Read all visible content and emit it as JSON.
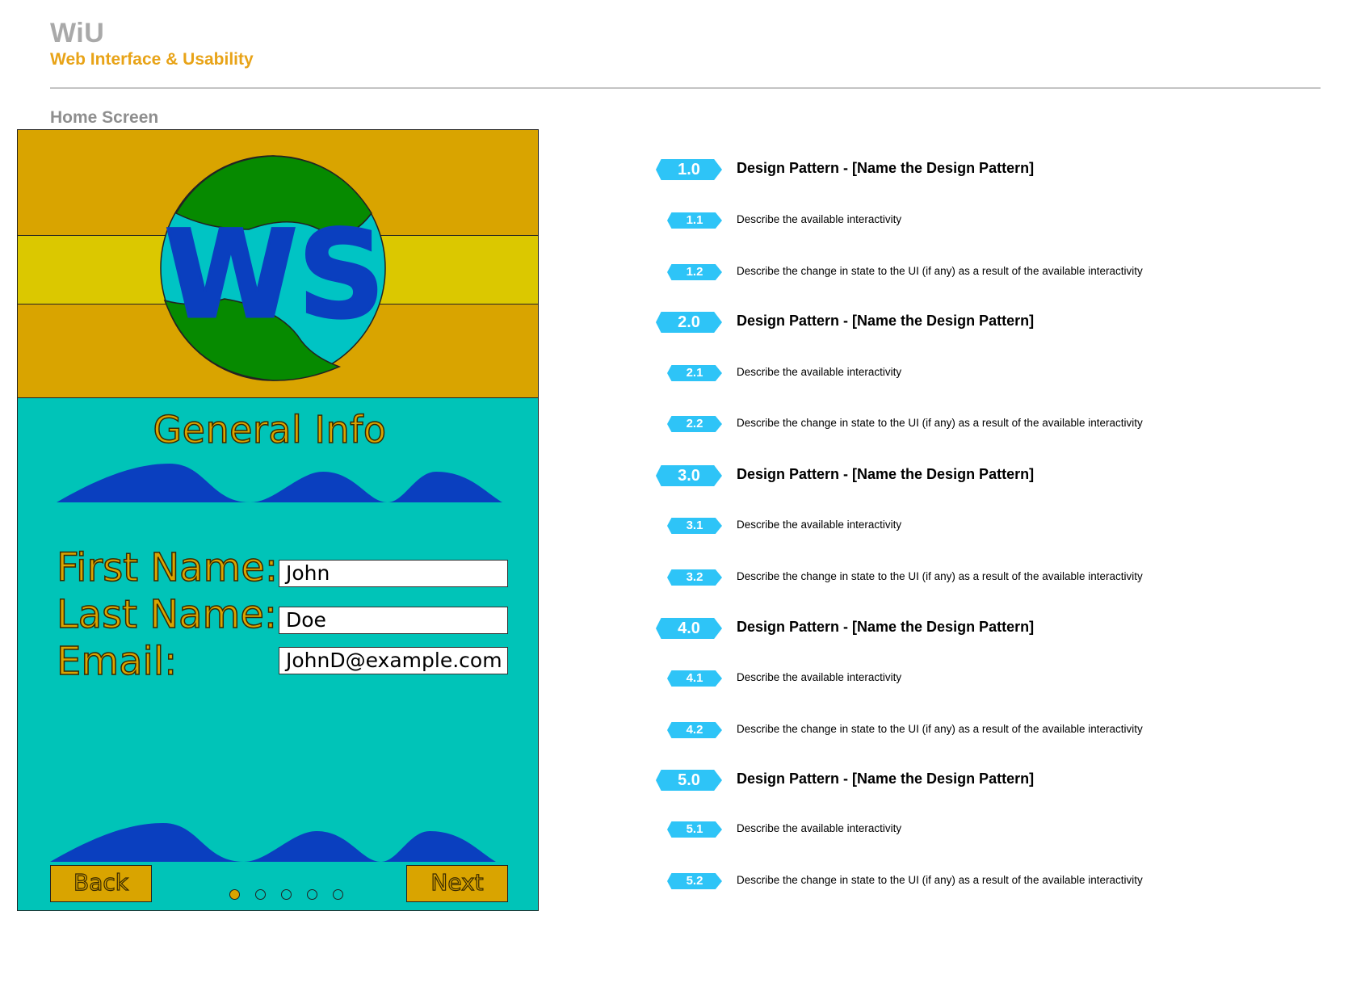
{
  "brand": {
    "title": "WiU",
    "subtitle": "Web Interface & Usability"
  },
  "screen_label": "Home Screen",
  "colors": {
    "accent_gold": "#d9a400",
    "stripe_yellow": "#dbc800",
    "teal": "#00c4b8",
    "wave_blue": "#0a3fbf",
    "globe_green": "#068a00",
    "globe_cyan": "#00c4c4",
    "badge_blue": "#2ec4f7"
  },
  "phone": {
    "logo_text": "WS",
    "section_title": "General Info",
    "form": [
      {
        "label": "First Name:",
        "value": "John"
      },
      {
        "label": "Last Name:",
        "value": "Doe"
      },
      {
        "label": "Email:",
        "value": "JohnD@example.com"
      }
    ],
    "back_label": "Back",
    "next_label": "Next",
    "pager": {
      "count": 5,
      "active_index": 0
    }
  },
  "annotations": [
    {
      "num": "1.0",
      "title": "Design Pattern - [Name the Design Pattern]",
      "items": [
        {
          "num": "1.1",
          "text": "Describe the available interactivity"
        },
        {
          "num": "1.2",
          "text": "Describe the change in state to the UI (if any) as a result of the available interactivity"
        }
      ]
    },
    {
      "num": "2.0",
      "title": "Design Pattern - [Name the Design Pattern]",
      "items": [
        {
          "num": "2.1",
          "text": "Describe the available interactivity"
        },
        {
          "num": "2.2",
          "text": "Describe the change in state to the UI (if any) as a result of the available interactivity"
        }
      ]
    },
    {
      "num": "3.0",
      "title": "Design Pattern - [Name the Design Pattern]",
      "items": [
        {
          "num": "3.1",
          "text": "Describe the available interactivity"
        },
        {
          "num": "3.2",
          "text": "Describe the change in state to the UI (if any) as a result of the available interactivity"
        }
      ]
    },
    {
      "num": "4.0",
      "title": "Design Pattern - [Name the Design Pattern]",
      "items": [
        {
          "num": "4.1",
          "text": "Describe the available interactivity"
        },
        {
          "num": "4.2",
          "text": "Describe the change in state to the UI (if any) as a result of the available interactivity"
        }
      ]
    },
    {
      "num": "5.0",
      "title": "Design Pattern - [Name the Design Pattern]",
      "items": [
        {
          "num": "5.1",
          "text": "Describe the available interactivity"
        },
        {
          "num": "5.2",
          "text": "Describe the change in state to the UI (if any) as a result of the available interactivity"
        }
      ]
    }
  ]
}
